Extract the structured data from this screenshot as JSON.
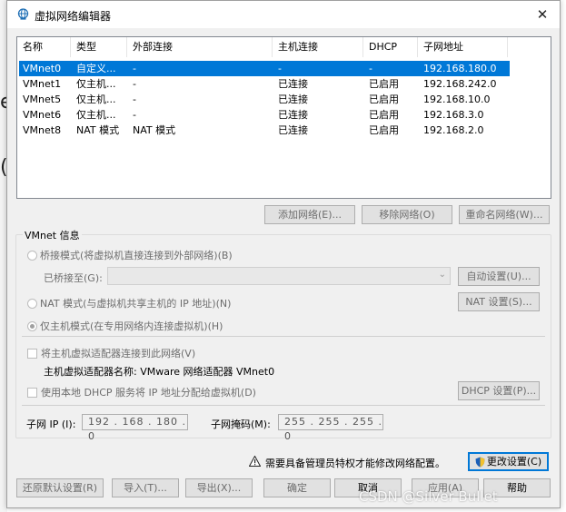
{
  "background": {
    "left_glyphs": [
      "e",
      "("
    ]
  },
  "window": {
    "title": "虚拟网络编辑器",
    "close": "✕"
  },
  "network_table": {
    "columns": [
      "名称",
      "类型",
      "外部连接",
      "主机连接",
      "DHCP",
      "子网地址"
    ],
    "rows": [
      [
        "VMnet0",
        "自定义...",
        "-",
        "-",
        "-",
        "192.168.180.0"
      ],
      [
        "VMnet1",
        "仅主机...",
        "-",
        "已连接",
        "已启用",
        "192.168.242.0"
      ],
      [
        "VMnet5",
        "仅主机...",
        "-",
        "已连接",
        "已启用",
        "192.168.10.0"
      ],
      [
        "VMnet6",
        "仅主机...",
        "-",
        "已连接",
        "已启用",
        "192.168.3.0"
      ],
      [
        "VMnet8",
        "NAT 模式",
        "NAT 模式",
        "已连接",
        "已启用",
        "192.168.2.0"
      ]
    ],
    "selected_index": 0
  },
  "table_buttons": {
    "add": "添加网络(E)...",
    "remove": "移除网络(O)",
    "rename": "重命名网络(W)..."
  },
  "vmnet_info": {
    "group_label": "VMnet 信息",
    "bridged_option": "桥接模式(将虚拟机直接连接到外部网络)(B)",
    "bridged_to_label": "已桥接至(G):",
    "auto_settings": "自动设置(U)...",
    "nat_option": "NAT 模式(与虚拟机共享主机的 IP 地址)(N)",
    "nat_settings": "NAT 设置(S)...",
    "hostonly_option": "仅主机模式(在专用网络内连接虚拟机)(H)",
    "connect_adapter": "将主机虚拟适配器连接到此网络(V)",
    "adapter_name": "主机虚拟适配器名称: VMware 网络适配器 VMnet0",
    "use_dhcp": "使用本地 DHCP 服务将 IP 地址分配给虚拟机(D)",
    "dhcp_settings": "DHCP 设置(P)...",
    "subnet_ip_label": "子网 IP (I):",
    "subnet_ip": "192 . 168 . 180 . 0",
    "subnet_mask_label": "子网掩码(M):",
    "subnet_mask": "255 . 255 . 255 . 0"
  },
  "admin": {
    "message": "需要具备管理员特权才能修改网络配置。",
    "change_settings": "更改设置(C)"
  },
  "footer_buttons": {
    "restore": "还原默认设置(R)",
    "import": "导入(T)...",
    "export": "导出(X)...",
    "ok": "确定",
    "cancel": "取消",
    "apply": "应用(A)",
    "help": "帮助"
  },
  "watermark": "CSDN @Silver    Bullet",
  "colors": {
    "selection": "#0078d7",
    "dialog_bg": "#f0f0f0",
    "disabled_text": "#6d6d6d"
  }
}
